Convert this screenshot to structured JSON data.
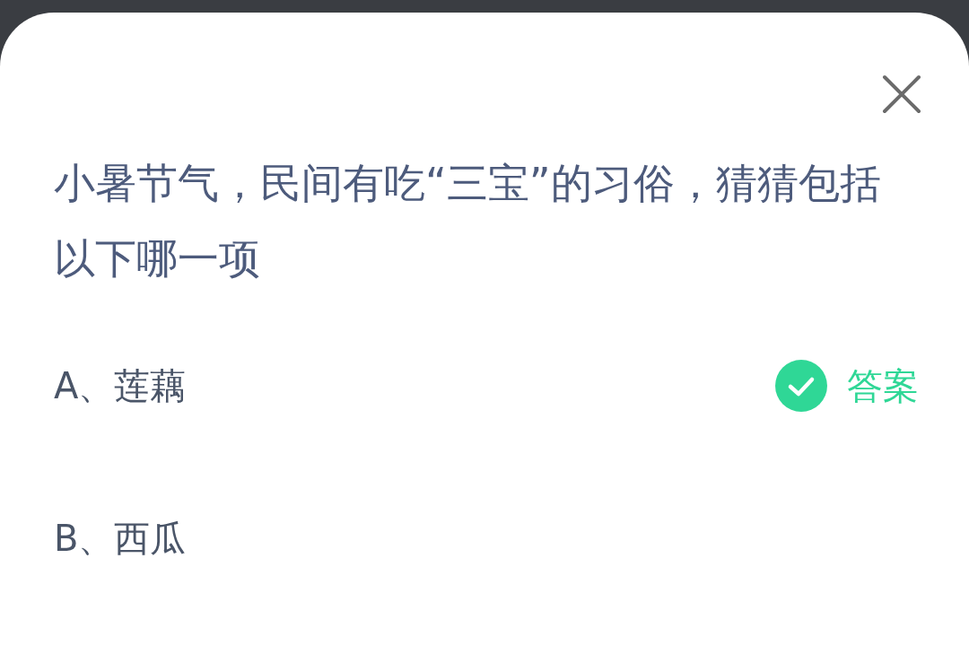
{
  "question": "小暑节气，民间有吃“三宝”的习俗，猜猜包括以下哪一项",
  "answer_label": "答案",
  "options": [
    {
      "label": "A、莲藕",
      "correct": true
    },
    {
      "label": "B、西瓜",
      "correct": false
    }
  ]
}
